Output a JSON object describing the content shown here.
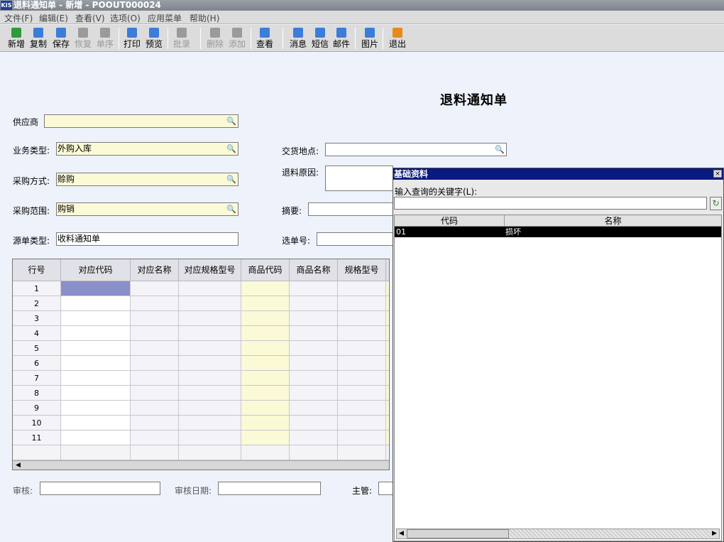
{
  "window": {
    "logo": "KIS",
    "title": "退料通知单 - 新增 - POOUT000024"
  },
  "menu": [
    "文件(F)",
    "编辑(E)",
    "查看(V)",
    "选项(O)",
    "应用菜单",
    "帮助(H)"
  ],
  "toolbar": [
    {
      "label": "新增",
      "icon": "add-icon",
      "color": "#2e9a3c",
      "disabled": false
    },
    {
      "label": "复制",
      "icon": "copy-icon",
      "color": "#3b7dd8",
      "disabled": false
    },
    {
      "label": "保存",
      "icon": "save-icon",
      "color": "#3b7dd8",
      "disabled": false
    },
    {
      "label": "恢复",
      "icon": "undo-icon",
      "color": "#9a9a9a",
      "disabled": true
    },
    {
      "label": "单序",
      "icon": "link-icon",
      "color": "#9a9a9a",
      "disabled": true
    },
    {
      "label": "打印",
      "icon": "print-icon",
      "color": "#3b7dd8",
      "disabled": false
    },
    {
      "label": "预览",
      "icon": "preview-icon",
      "color": "#3b7dd8",
      "disabled": false
    },
    {
      "label": "批录",
      "icon": "batch-icon",
      "color": "#9a9a9a",
      "disabled": true
    },
    {
      "label": "删除",
      "icon": "delete-row-icon",
      "color": "#9a9a9a",
      "disabled": true
    },
    {
      "label": "添加",
      "icon": "add-row-icon",
      "color": "#9a9a9a",
      "disabled": true
    },
    {
      "label": "查看",
      "icon": "view-icon",
      "color": "#3b7dd8",
      "disabled": false
    },
    {
      "label": "消息",
      "icon": "message-icon",
      "color": "#3b7dd8",
      "disabled": false
    },
    {
      "label": "短信",
      "icon": "sms-icon",
      "color": "#3b7dd8",
      "disabled": false
    },
    {
      "label": "邮件",
      "icon": "mail-icon",
      "color": "#3b7dd8",
      "disabled": false
    },
    {
      "label": "图片",
      "icon": "image-icon",
      "color": "#3b7dd8",
      "disabled": false
    },
    {
      "label": "退出",
      "icon": "exit-icon",
      "color": "#e68a1a",
      "disabled": false
    }
  ],
  "form": {
    "title": "退料通知单",
    "supplier": {
      "label": "供应商",
      "value": ""
    },
    "biz_type": {
      "label": "业务类型:",
      "value": "外购入库"
    },
    "purchase_method": {
      "label": "采购方式:",
      "value": "赊购"
    },
    "purchase_scope": {
      "label": "采购范围:",
      "value": "购销"
    },
    "source_type": {
      "label": "源单类型:",
      "value": "收料通知单"
    },
    "delivery_place": {
      "label": "交货地点:",
      "value": ""
    },
    "return_reason": {
      "label": "退料原因:",
      "value": ""
    },
    "summary": {
      "label": "摘要:",
      "value": ""
    },
    "select_no": {
      "label": "选单号:",
      "value": ""
    }
  },
  "grid": {
    "columns": [
      "行号",
      "对应代码",
      "对应名称",
      "对应规格型号",
      "商品代码",
      "商品名称",
      "规格型号"
    ],
    "rows": [
      "1",
      "2",
      "3",
      "4",
      "5",
      "6",
      "7",
      "8",
      "9",
      "10",
      "11"
    ]
  },
  "footer": {
    "auditor_label": "审核:",
    "audit_date_label": "审核日期:",
    "manager_label": "主管:"
  },
  "popup": {
    "title": "基础资料",
    "close": "×",
    "search_label": "输入查询的关键字(L):",
    "columns": [
      "代码",
      "名称"
    ],
    "rows": [
      {
        "code": "01",
        "name": "损坏"
      }
    ]
  }
}
